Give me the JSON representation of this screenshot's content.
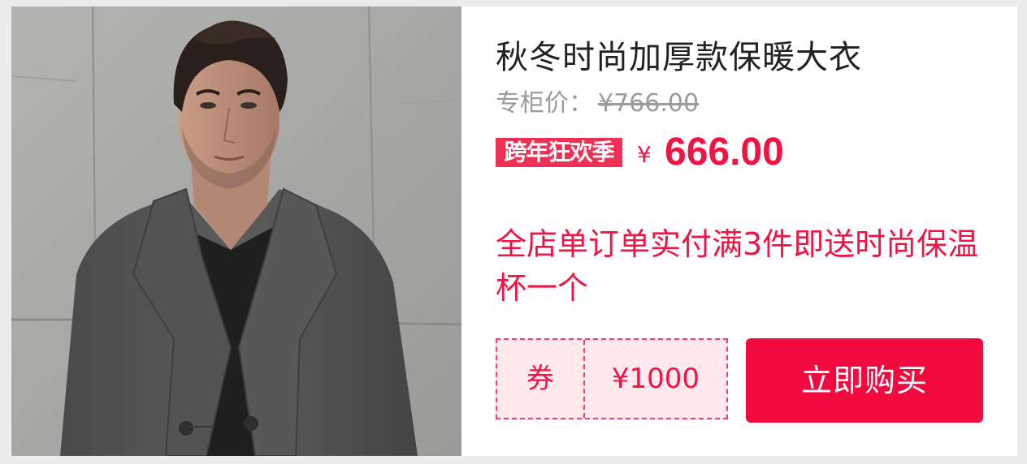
{
  "product": {
    "title": "秋冬时尚加厚款保暖大衣",
    "original_price_label": "专柜价：",
    "original_price": "¥766.00",
    "promo_badge": "跨年狂欢季",
    "currency": "¥",
    "price": "666.00",
    "promotion": "全店单订单实付满3件即送时尚保温杯一个",
    "image_alt": "man-in-grey-wool-coat"
  },
  "coupon": {
    "label": "券",
    "value": "¥1000"
  },
  "actions": {
    "buy_label": "立即购买"
  },
  "colors": {
    "accent": "#f20a3e",
    "price": "#f01444",
    "coupon_bg": "#ffe8ee",
    "muted": "#9b9b9b"
  }
}
